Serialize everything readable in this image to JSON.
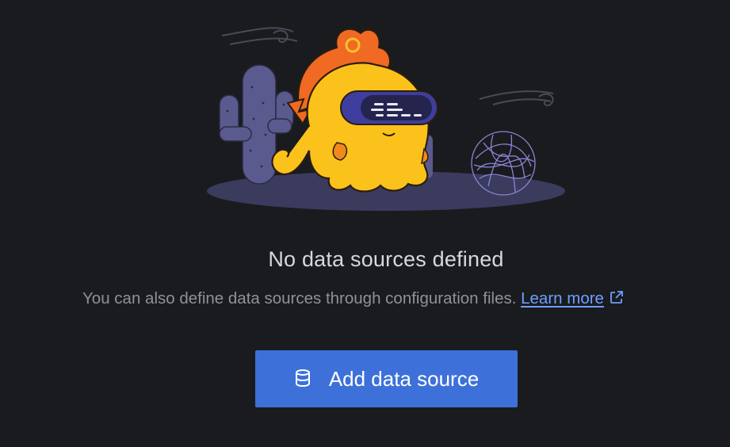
{
  "empty_state": {
    "title": "No data sources defined",
    "description": "You can also define data sources through configuration files.",
    "learn_more_label": "Learn more",
    "learn_more_icon": "external-link-icon"
  },
  "primary_action": {
    "label": "Add data source",
    "icon": "database-icon"
  },
  "colors": {
    "background": "#1a1b1f",
    "button": "#3d71d9",
    "link": "#6e9fff"
  }
}
